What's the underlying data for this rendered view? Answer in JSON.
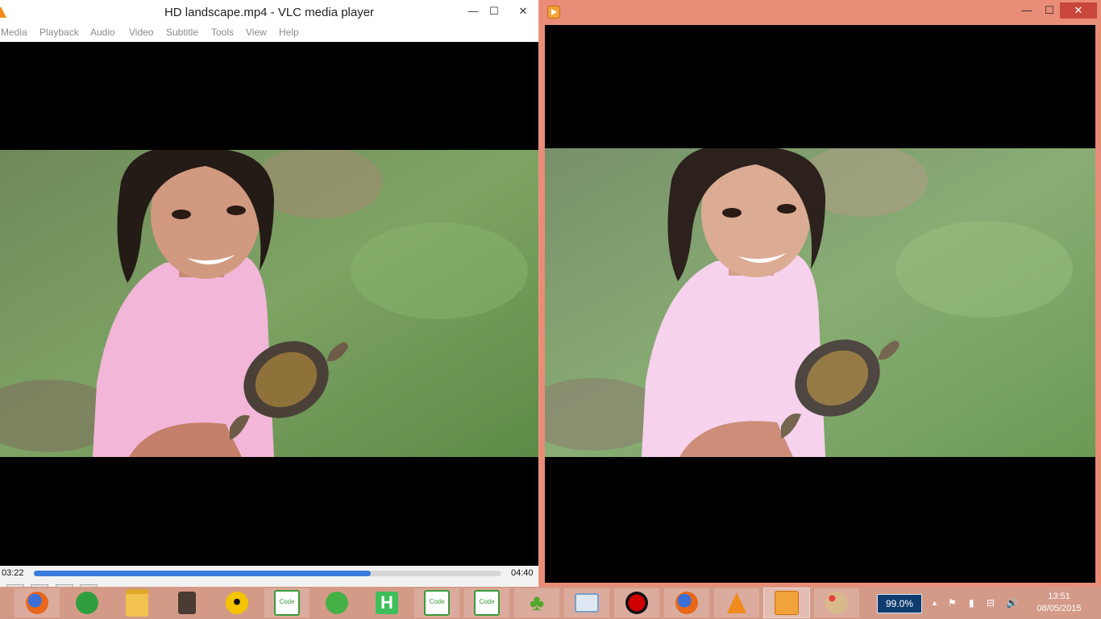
{
  "vlc": {
    "title": "HD landscape.mp4 - VLC media player",
    "controls": {
      "minimize": "—",
      "maximize": "☐",
      "close": "✕"
    },
    "menu": [
      "Media",
      "Playback",
      "Audio",
      "Video",
      "Subtitle",
      "Tools",
      "View",
      "Help"
    ],
    "elapsed": "03:22",
    "total": "04:40",
    "progress": 0.72
  },
  "preview": {
    "controls": {
      "minimize": "—",
      "maximize": "☐",
      "close": "✕"
    }
  },
  "taskbar": {
    "apps": [
      {
        "icon": "firefox-icon",
        "color": "#e8671a"
      },
      {
        "icon": "green-app-icon",
        "color": "#2f9e3f"
      },
      {
        "icon": "file-explorer-icon",
        "color": "#f1c24e"
      },
      {
        "icon": "speaker-app-icon",
        "color": "#4a3b33"
      },
      {
        "icon": "sunglasses-smiley-icon",
        "color": "#f5c400"
      },
      {
        "icon": "code-app-icon",
        "label": "Code",
        "color": "#3b9a3b"
      },
      {
        "icon": "green-download-icon",
        "color": "#45b046"
      },
      {
        "icon": "h-app-icon",
        "label": "H",
        "color": "#3fbf5a"
      },
      {
        "icon": "code-app-icon",
        "label": "Code",
        "color": "#3b9a3b"
      },
      {
        "icon": "code-app-icon",
        "label": "Code",
        "color": "#3b9a3b"
      },
      {
        "icon": "clover-icon",
        "color": "#4daa2a"
      },
      {
        "icon": "monitor-app-icon",
        "color": "#7aa0c8"
      },
      {
        "icon": "record-icon",
        "color": "#d00000"
      },
      {
        "icon": "firefox-icon",
        "color": "#e8671a"
      },
      {
        "icon": "vlc-cone-icon",
        "color": "#f08a1c"
      },
      {
        "icon": "video-preview-icon",
        "color": "#f2a23a"
      },
      {
        "icon": "paint-palette-icon",
        "color": "#d9b98a"
      }
    ],
    "battery": "99.0%",
    "tray": {
      "chevron": "▲",
      "flag": "⚑",
      "power": "▮",
      "network": "⊟",
      "volume": "🔊"
    },
    "time": "13:51",
    "date": "08/05/2015"
  }
}
